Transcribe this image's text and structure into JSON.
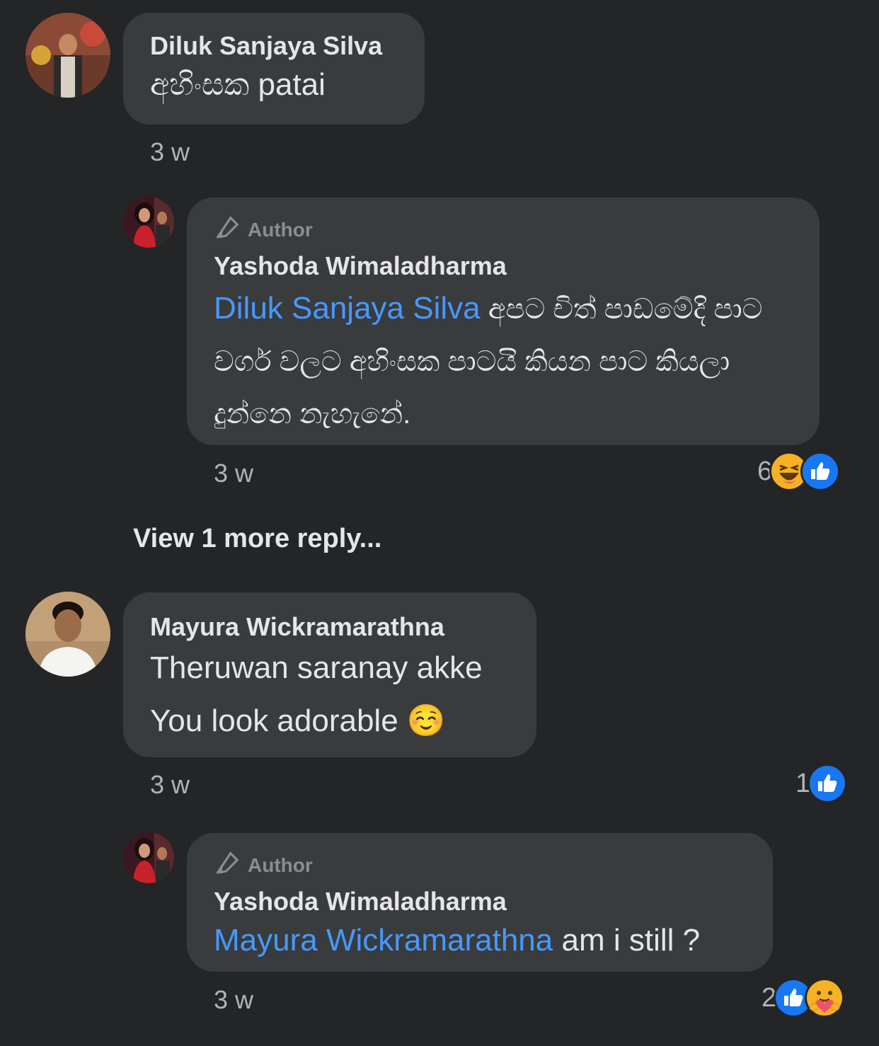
{
  "comments": [
    {
      "name": "Diluk Sanjaya Silva",
      "text": "අහිංසක patai",
      "time": "3 w"
    },
    {
      "badge": "Author",
      "name": "Yashoda Wimaladharma",
      "mention": "Diluk Sanjaya Silva",
      "text_line1": " අපට චිත් පාඩමේදි පාට",
      "text_line2": "වර්ග වලට අහිංසක පාටයි කියන පාට කියලා",
      "text_line3": "දුන්නෙ නැහැනේ.",
      "time": "3 w",
      "reaction_count": "6",
      "reactions": [
        "haha-icon",
        "like-icon"
      ]
    },
    {
      "name": "Mayura Wickramarathna",
      "text_line1": "Theruwan saranay akke",
      "text_line2": "You look adorable ☺️",
      "time": "3 w",
      "reaction_count": "1",
      "reactions": [
        "like-icon"
      ]
    },
    {
      "badge": "Author",
      "name": "Yashoda Wimaladharma",
      "mention": "Mayura Wickramarathna",
      "text": " am i still ?",
      "time": "3 w",
      "reaction_count": "2",
      "reactions": [
        "like-icon",
        "care-icon"
      ]
    }
  ],
  "view_more": "View 1 more reply...",
  "colors": {
    "background": "#242527",
    "bubble": "#3a3b3c",
    "mention": "#4599ff",
    "like": "#1877f2"
  }
}
